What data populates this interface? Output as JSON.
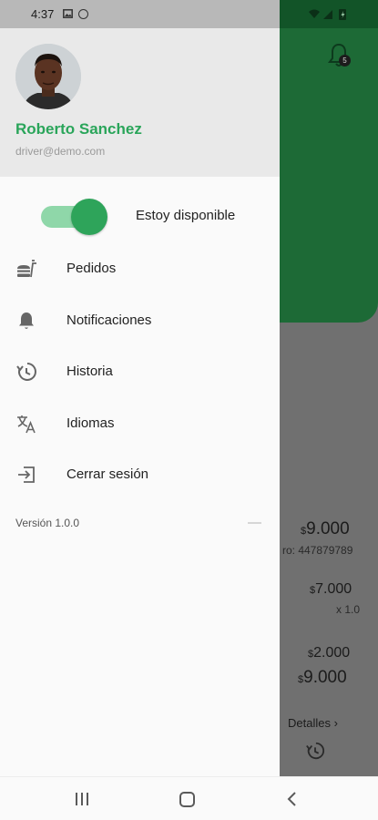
{
  "status_bar": {
    "time": "4:37",
    "icons": [
      "image-icon",
      "circle-icon",
      "wifi-icon",
      "signal-icon",
      "battery-icon"
    ]
  },
  "drawer": {
    "user": {
      "name": "Roberto Sanchez",
      "email": "driver@demo.com"
    },
    "availability": {
      "label": "Estoy disponible",
      "on": true
    },
    "menu": [
      {
        "label": "Pedidos",
        "icon": "food-icon"
      },
      {
        "label": "Notificaciones",
        "icon": "bell-icon"
      },
      {
        "label": "Historia",
        "icon": "history-icon"
      },
      {
        "label": "Idiomas",
        "icon": "translate-icon"
      },
      {
        "label": "Cerrar sesión",
        "icon": "logout-icon"
      }
    ],
    "version": "Versión 1.0.0"
  },
  "background": {
    "notification_badge": "5",
    "currency": "$",
    "total_1": "9.000",
    "reference": "ro: 447879789",
    "subtotal_1": "7.000",
    "quantity": "x 1.0",
    "subtotal_2": "2.000",
    "total_2": "9.000",
    "details_label": "Detalles"
  },
  "colors": {
    "accent_green": "#2ea45a",
    "name_green": "#2aa55a",
    "header_dim_green": "#1d6a36",
    "scrim_gray": "#707070"
  }
}
